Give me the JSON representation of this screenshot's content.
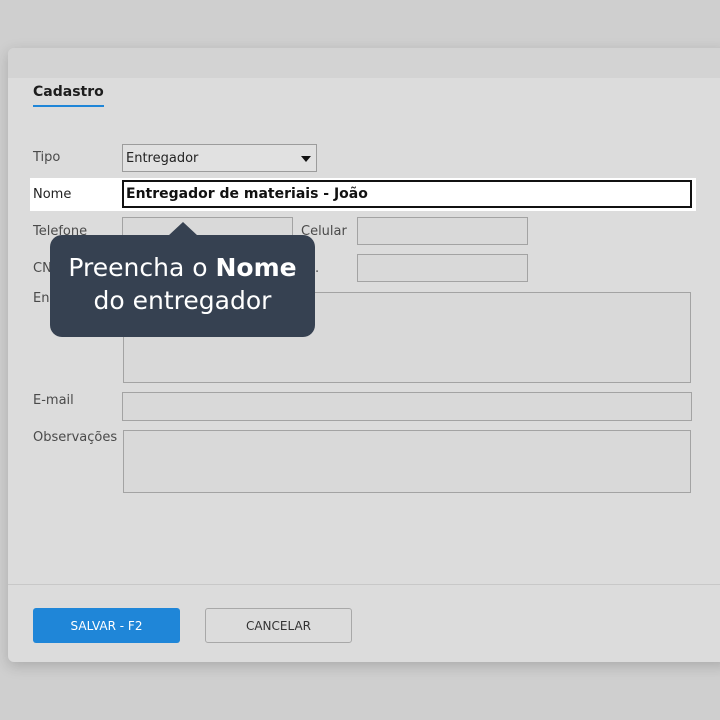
{
  "tab": {
    "label": "Cadastro"
  },
  "form": {
    "tipo": {
      "label": "Tipo",
      "value": "Entregador"
    },
    "nome": {
      "label": "Nome",
      "value": "Entregador de materiais - João"
    },
    "telefone": {
      "label": "Telefone",
      "value": ""
    },
    "celular": {
      "label": "Celular",
      "value": ""
    },
    "cnpj_label_fragment": "CN",
    "second_label_fragment": ".",
    "endereco_label_fragment": "En",
    "email": {
      "label": "E-mail",
      "value": ""
    },
    "observacoes": {
      "label": "Observações",
      "value": ""
    }
  },
  "buttons": {
    "save": "SALVAR - F2",
    "cancel": "CANCELAR"
  },
  "tooltip": {
    "line1_prefix": "Preencha o ",
    "line1_bold": "Nome",
    "line2": "do entregador"
  },
  "colors": {
    "accent": "#1f86d8",
    "tooltip_bg": "#364151"
  }
}
